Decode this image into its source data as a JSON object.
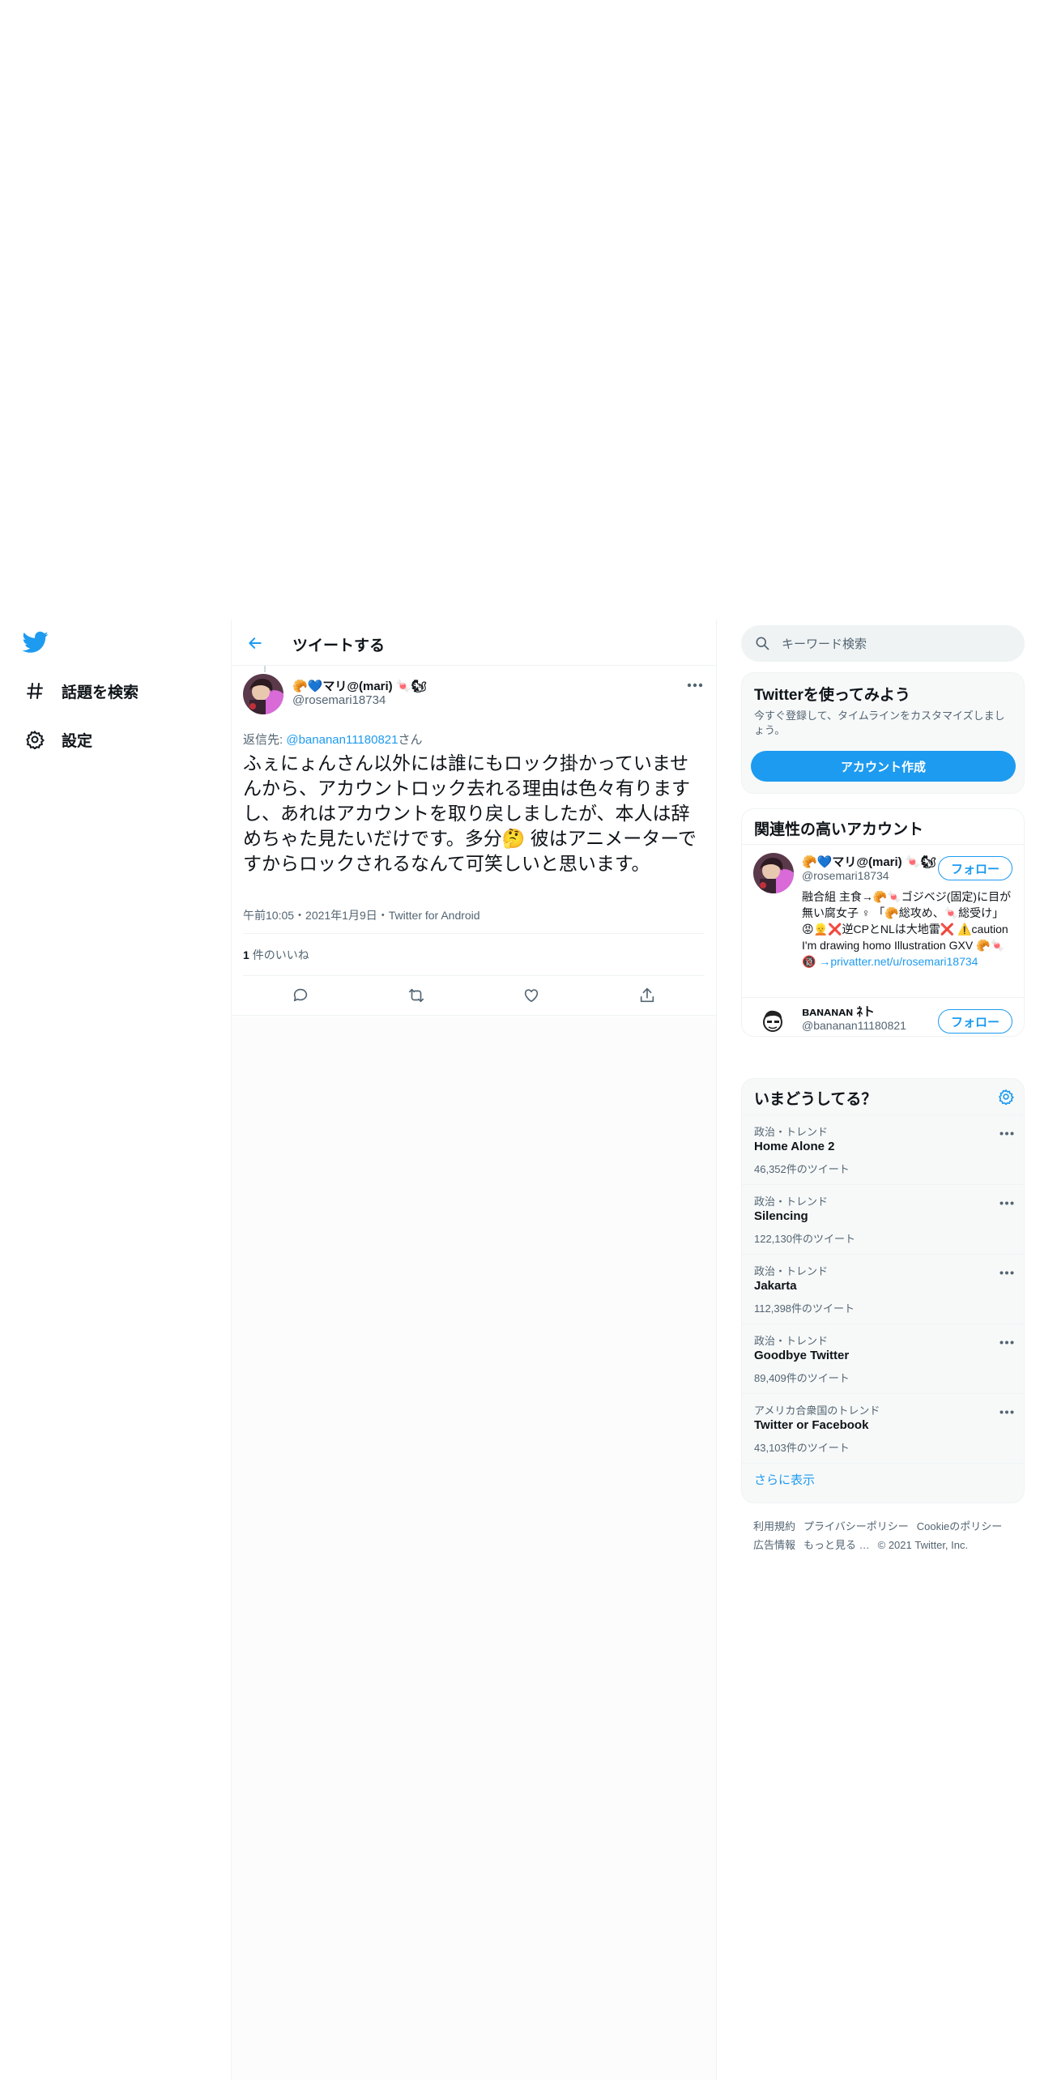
{
  "nav": {
    "items": [
      {
        "label": "話題を検索"
      },
      {
        "label": "設定"
      }
    ]
  },
  "header": {
    "title": "ツイートする"
  },
  "tweet": {
    "display_name": "🥐💙マリ@(mari) 🍬🐿",
    "handle": "@rosemari18734",
    "reply_prefix": "返信先:",
    "reply_mention": "@bananan11180821",
    "reply_suffix": "さん",
    "text": "ふぇにょんさん以外には誰にもロック掛かっていませんから、アカウントロック去れる理由は色々有りますし、あれはアカウントを取り戻しましたが、本人は辞めちゃた見たいだけです。多分🤔 彼はアニメーターですからロックされるなんて可笑しいと思います。",
    "meta": "午前10:05・2021年1月9日・Twitter for Android",
    "likes_count": "1",
    "likes_label": "件のいいね"
  },
  "search": {
    "placeholder": "キーワード検索"
  },
  "signup_card": {
    "title": "Twitterを使ってみよう",
    "description": "今すぐ登録して、タイムラインをカスタマイズしましょう。",
    "button_label": "アカウント作成"
  },
  "related": {
    "title": "関連性の高いアカウント",
    "accounts": [
      {
        "name": "🥐💙マリ@(mari) 🍬🐿",
        "handle": "@rosemari18734",
        "bio": "融合組 主食→🥐🍬ゴジベジ(固定)に目が無い腐女子 ♀ 「🥐総攻め、🍬総受け」😡👱❌逆CPとNLは大地雷❌ ⚠️caution I'm drawing homo Illustration GXV 🥐🍬 🔞",
        "bio_link": "→privatter.net/u/rosemari18734",
        "follow_label": "フォロー"
      },
      {
        "name": "ʙᴀɴᴀɴᴀɴ ﾈト",
        "handle": "@bananan11180821",
        "bio": "□□",
        "follow_label": "フォロー"
      }
    ]
  },
  "trends": {
    "title": "いまどうしてる？",
    "items": [
      {
        "context": "政治・トレンド",
        "name": "Home Alone 2",
        "count": "46,352件のツイート"
      },
      {
        "context": "政治・トレンド",
        "name": "Silencing",
        "count": "122,130件のツイート"
      },
      {
        "context": "政治・トレンド",
        "name": "Jakarta",
        "count": "112,398件のツイート"
      },
      {
        "context": "政治・トレンド",
        "name": "Goodbye Twitter",
        "count": "89,409件のツイート"
      },
      {
        "context": "アメリカ合衆国のトレンド",
        "name": "Twitter or Facebook",
        "count": "43,103件のツイート"
      }
    ],
    "show_more": "さらに表示"
  },
  "footer": {
    "links": [
      "利用規約",
      "プライバシーポリシー",
      "Cookieのポリシー",
      "広告情報",
      "もっと見る …"
    ],
    "copyright": "© 2021 Twitter, Inc."
  },
  "colors": {
    "accent": "#1d9bf0",
    "text": "#0f1419",
    "secondary": "#536471",
    "border": "#eff3f4"
  }
}
